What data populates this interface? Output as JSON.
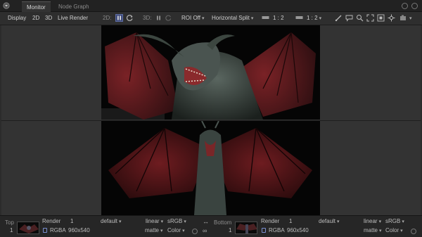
{
  "tabs": {
    "monitor": "Monitor",
    "node_graph": "Node Graph"
  },
  "toolbar": {
    "display": "Display",
    "mode_2d": "2D",
    "mode_3d": "3D",
    "live_render": "Live Render",
    "label_2d": "2D:",
    "label_3d": "3D:",
    "roi": "ROI Off",
    "split": "Horizontal Split",
    "ratio_a": "1 : 2",
    "ratio_b": "1 : 2"
  },
  "status": {
    "top": {
      "position_label": "Top",
      "slot": "1",
      "node": "Render",
      "frame": "1",
      "pass": "default",
      "format": "RGBA",
      "resolution": "960x540",
      "space": "linear",
      "lut": "sRGB",
      "matte": "matte",
      "color": "Color"
    },
    "bottom": {
      "position_label": "Bottom",
      "slot": "1",
      "node": "Render",
      "frame": "1",
      "pass": "default",
      "format": "RGBA",
      "resolution": "960x540",
      "space": "linear",
      "lut": "sRGB",
      "matte": "matte",
      "color": "Color"
    }
  },
  "colors": {
    "accent": "#7a8fd0",
    "panel": "#2b2b2b",
    "render_bg": "#050505",
    "wing_red": "#6b1e22",
    "dragon_body": "#3c4640"
  },
  "icons": [
    "menu-icon",
    "pause-icon",
    "refresh-icon",
    "brush-icon",
    "comment-icon",
    "zoom-icon",
    "fit-icon",
    "frame-icon",
    "center-icon",
    "snapshot-icon",
    "swap-icon",
    "link-icon"
  ]
}
